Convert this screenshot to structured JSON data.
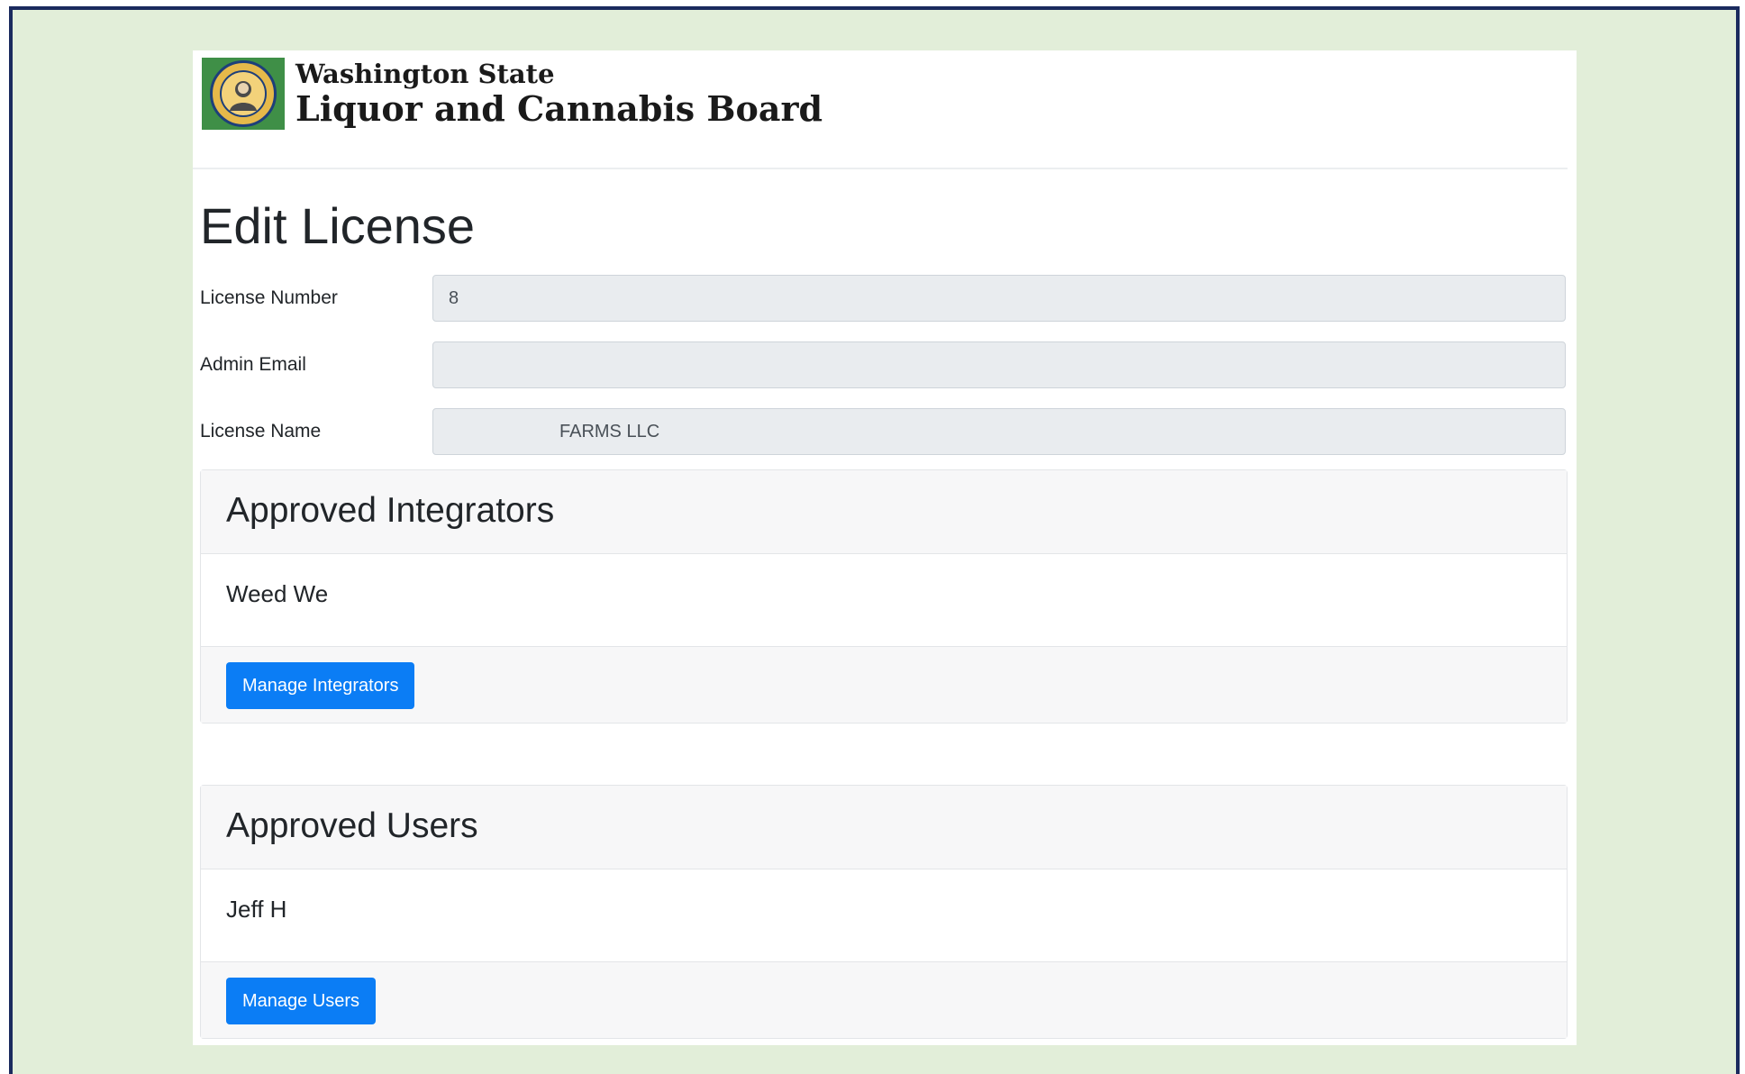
{
  "header": {
    "brand_line1": "Washington State",
    "brand_line2": "Liquor and Cannabis Board",
    "seal_icon": "washington-state-seal-icon"
  },
  "page": {
    "title": "Edit License"
  },
  "form": {
    "license_number": {
      "label": "License Number",
      "value": "8"
    },
    "admin_email": {
      "label": "Admin Email",
      "value": ""
    },
    "license_name": {
      "label": "License Name",
      "value": "FARMS LLC"
    }
  },
  "integrators": {
    "heading": "Approved Integrators",
    "items": [
      "Weed We"
    ],
    "button_label": "Manage Integrators"
  },
  "users": {
    "heading": "Approved Users",
    "items": [
      "Jeff H"
    ],
    "button_label": "Manage Users"
  },
  "colors": {
    "frame_background": "#e2eed9",
    "frame_border": "#1a2a5e",
    "primary_button": "#0b7df5",
    "seal_green": "#3f8f47"
  }
}
